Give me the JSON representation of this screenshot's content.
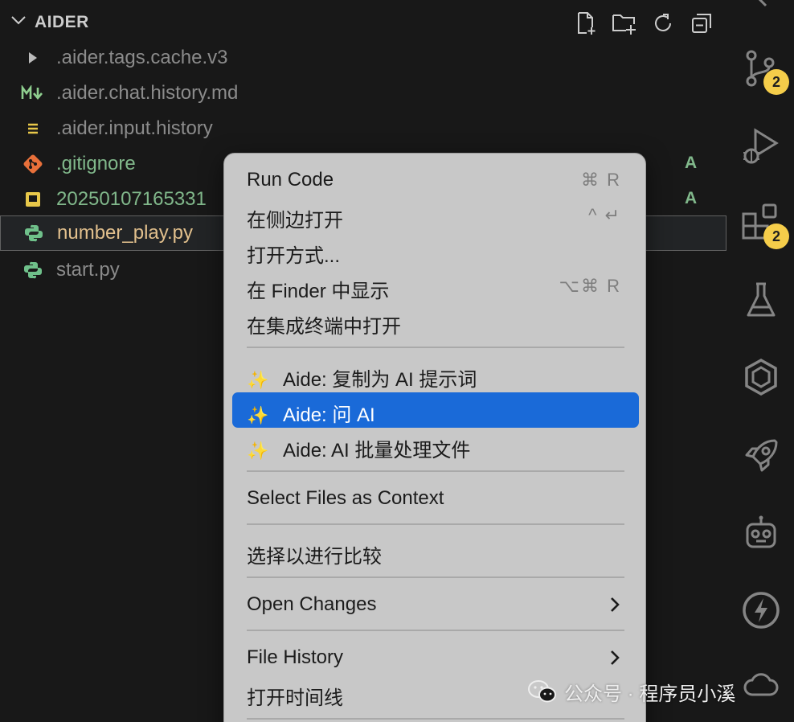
{
  "explorer": {
    "section_title": "AIDER",
    "files": [
      {
        "name": ".aider.tags.cache.v3",
        "icon": "folder-chevron-right-icon",
        "badge": ""
      },
      {
        "name": ".aider.chat.history.md",
        "icon": "markdown-icon",
        "badge": ""
      },
      {
        "name": ".aider.input.history",
        "icon": "text-lines-icon",
        "badge": ""
      },
      {
        "name": ".gitignore",
        "icon": "git-icon",
        "badge": "A"
      },
      {
        "name": "20250107165331",
        "icon": "file-box-icon",
        "badge": "A"
      },
      {
        "name": "number_play.py",
        "icon": "python-icon",
        "badge": ""
      },
      {
        "name": "start.py",
        "icon": "python-icon",
        "badge": ""
      }
    ]
  },
  "activity_bar": {
    "source_control_badge": "2",
    "extensions_badge": "2"
  },
  "context_menu": {
    "items": [
      {
        "label": "Run Code",
        "shortcut": "⌘ R"
      },
      {
        "label": "在侧边打开",
        "shortcut": "^ ↵"
      },
      {
        "label": "打开方式...",
        "shortcut": ""
      },
      {
        "label": "在 Finder 中显示",
        "shortcut": "⌥⌘ R"
      },
      {
        "label": "在集成终端中打开",
        "shortcut": ""
      },
      {
        "label": "Aide: 复制为 AI 提示词",
        "shortcut": ""
      },
      {
        "label": "Aide: 问 AI",
        "shortcut": ""
      },
      {
        "label": "Aide: AI 批量处理文件",
        "shortcut": ""
      },
      {
        "label": "Select Files as Context",
        "shortcut": ""
      },
      {
        "label": "选择以进行比较",
        "shortcut": ""
      },
      {
        "label": "Open Changes",
        "shortcut": ""
      },
      {
        "label": "File History",
        "shortcut": ""
      },
      {
        "label": "打开时间线",
        "shortcut": ""
      }
    ],
    "sparkle": "✨"
  },
  "watermark": {
    "text": "公众号 · 程序员小溪"
  },
  "colors": {
    "background": "#181818",
    "menu_background": "#c8c8c8",
    "menu_highlight": "#1a6ad8",
    "git_added": "#81b88b",
    "modified_yellow": "#e2c08d",
    "badge": "#f5cd4a"
  }
}
